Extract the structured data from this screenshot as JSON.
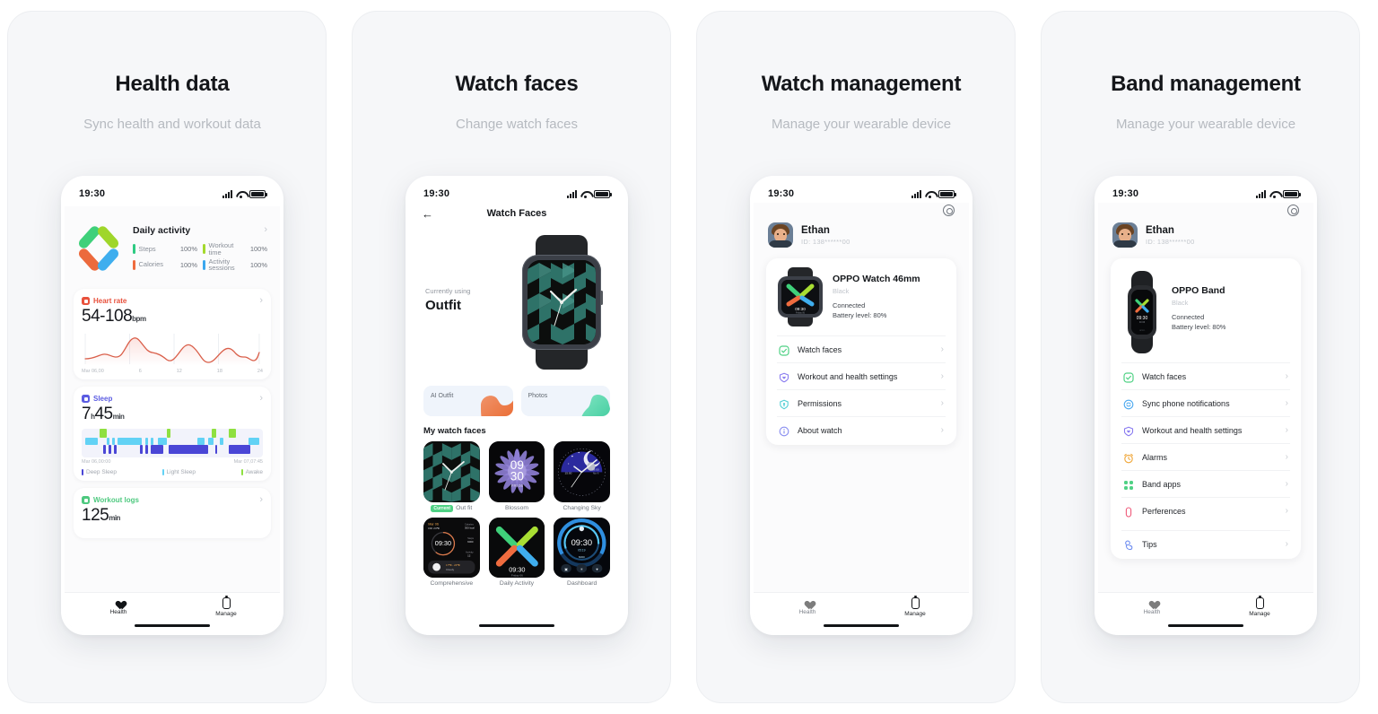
{
  "panels": [
    {
      "title": "Health data",
      "subtitle": "Sync health and workout data",
      "status": {
        "time": "19:30"
      },
      "daily": {
        "title": "Daily activity",
        "stats": [
          {
            "name": "Steps",
            "value": "100%",
            "color": "#2ecb82"
          },
          {
            "name": "Workout time",
            "value": "100%",
            "color": "#a4d92c"
          },
          {
            "name": "Calories",
            "value": "100%",
            "color": "#ef6c3f"
          },
          {
            "name": "Activity sessions",
            "value": "100%",
            "color": "#3ba7ee"
          }
        ]
      },
      "heart": {
        "title": "Heart rate",
        "color": "#e8513c",
        "value": "54-108",
        "unit": "bpm",
        "axis": [
          "Mar 06,00",
          "6",
          "12",
          "18",
          "24"
        ]
      },
      "sleep": {
        "title": "Sleep",
        "color": "#5b5ce2",
        "hours": "7",
        "hours_unit": "h",
        "minutes": "45",
        "minutes_unit": "min",
        "range_start": "Mar 06,00:00",
        "range_end": "Mar 07,07:45",
        "legend": [
          {
            "label": "Deep Sleep",
            "color": "#4a46d6"
          },
          {
            "label": "Light Sleep",
            "color": "#62d2f5"
          },
          {
            "label": "Awake",
            "color": "#8fe040"
          }
        ]
      },
      "workout": {
        "title": "Workout logs",
        "color": "#4ec97f",
        "value": "125",
        "unit": "min"
      },
      "tabs": [
        {
          "label": "Health",
          "icon": "heart-icon"
        },
        {
          "label": "Manage",
          "icon": "watch-icon"
        }
      ]
    },
    {
      "title": "Watch faces",
      "subtitle": "Change watch faces",
      "status": {
        "time": "19:30"
      },
      "nav": {
        "back": "←",
        "title": "Watch Faces"
      },
      "current": {
        "label": "Currently using",
        "name": "Outfit"
      },
      "tiles": [
        {
          "label": "AI Outfit",
          "color": "#ef8a5e"
        },
        {
          "label": "Photos",
          "color": "#57d6a8"
        }
      ],
      "section": "My watch faces",
      "faces": [
        {
          "name": "Out fit",
          "badge": "Current",
          "style": "cube"
        },
        {
          "name": "Blossom",
          "badge": "",
          "style": "blossom"
        },
        {
          "name": "Changing Sky",
          "badge": "",
          "style": "sky"
        },
        {
          "name": "Comprehensive",
          "badge": "",
          "style": "comprehensive"
        },
        {
          "name": "Daily Activity",
          "badge": "",
          "style": "dailyx"
        },
        {
          "name": "Dashboard",
          "badge": "",
          "style": "dashboard"
        }
      ]
    },
    {
      "title": "Watch management",
      "subtitle": "Manage your wearable device",
      "status": {
        "time": "19:30"
      },
      "profile": {
        "name": "Ethan",
        "id": "ID: 138******00"
      },
      "device": {
        "name": "OPPO Watch 46mm",
        "color": "Black",
        "status": "Connected",
        "battery": "Battery level: 80%",
        "type": "watch",
        "face_time": "09:30",
        "face_date": "Friday 06"
      },
      "menu": [
        {
          "label": "Watch faces",
          "icon": "watch-face-icon",
          "color": "#4fd184"
        },
        {
          "label": "Workout and health settings",
          "icon": "heart-shield-icon",
          "color": "#8a7cf0"
        },
        {
          "label": "Permissions",
          "icon": "lock-icon",
          "color": "#53cfd4"
        },
        {
          "label": "About watch",
          "icon": "info-icon",
          "color": "#8a8ff0"
        }
      ],
      "tabs": [
        {
          "label": "Health",
          "icon": "heart-icon"
        },
        {
          "label": "Manage",
          "icon": "watch-icon"
        }
      ]
    },
    {
      "title": "Band management",
      "subtitle": "Manage your wearable device",
      "status": {
        "time": "19:30"
      },
      "profile": {
        "name": "Ethan",
        "id": "ID: 138******00"
      },
      "device": {
        "name": "OPPO Band",
        "color": "Black",
        "status": "Connected",
        "battery": "Battery level: 80%",
        "type": "band",
        "face_time": "09:30",
        "face_date": "Fri 06"
      },
      "menu": [
        {
          "label": "Watch faces",
          "icon": "watch-face-icon",
          "color": "#4fd184"
        },
        {
          "label": "Sync phone notifications",
          "icon": "sync-icon",
          "color": "#4aa8f0"
        },
        {
          "label": "Workout and health settings",
          "icon": "heart-shield-icon",
          "color": "#8a7cf0"
        },
        {
          "label": "Alarms",
          "icon": "alarm-icon",
          "color": "#f0a83c"
        },
        {
          "label": "Band apps",
          "icon": "apps-icon",
          "color": "#4fd184"
        },
        {
          "label": "Perferences",
          "icon": "band-icon",
          "color": "#ef5a7a"
        },
        {
          "label": "Tips",
          "icon": "tips-icon",
          "color": "#6d8cf0"
        }
      ],
      "tabs": [
        {
          "label": "Health",
          "icon": "heart-icon"
        },
        {
          "label": "Manage",
          "icon": "watch-icon"
        }
      ]
    }
  ],
  "chart_data": [
    {
      "type": "line",
      "title": "Heart rate",
      "ylabel": "bpm",
      "x": [
        "Mar 06,00",
        "6",
        "12",
        "18",
        "24"
      ],
      "values": [
        60,
        66,
        62,
        70,
        104,
        80,
        66,
        58,
        86,
        70,
        56,
        62,
        92,
        78,
        66,
        70
      ],
      "range_label": "54-108"
    },
    {
      "type": "bar",
      "title": "Sleep",
      "categories": [
        "Deep Sleep",
        "Light Sleep",
        "Awake"
      ],
      "colors": [
        "#4a46d6",
        "#62d2f5",
        "#8fe040"
      ],
      "total": "7h 45min",
      "xlabel_start": "Mar 06,00:00",
      "xlabel_end": "Mar 07,07:45"
    }
  ]
}
